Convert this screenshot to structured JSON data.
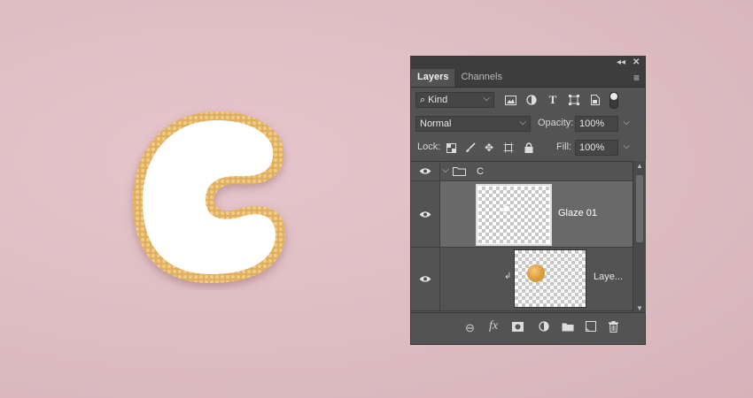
{
  "canvas": {
    "background": "#ddbcc2",
    "cookie_icing": "#ffffff",
    "cookie_crust": "#e2b466"
  },
  "panel": {
    "tabs": [
      {
        "label": "Layers",
        "active": true
      },
      {
        "label": "Channels",
        "active": false
      }
    ],
    "filter": {
      "kind_label": "Kind"
    },
    "blend_mode": "Normal",
    "opacity_label": "Opacity:",
    "opacity_value": "100%",
    "lock_label": "Lock:",
    "fill_label": "Fill:",
    "fill_value": "100%",
    "layers": [
      {
        "name": "C",
        "type": "group",
        "visible": true,
        "expanded": true
      },
      {
        "name": "Glaze 01",
        "type": "layer",
        "visible": true,
        "selected": true
      },
      {
        "name": "Laye...",
        "type": "layer",
        "visible": true,
        "clipped": true
      }
    ]
  },
  "icons": [
    "collapse-icon",
    "close-icon",
    "panel-menu-icon",
    "search-icon",
    "image-filter-icon",
    "adjustment-filter-icon",
    "type-filter-icon",
    "shape-filter-icon",
    "smart-object-filter-icon",
    "filter-toggle-icon",
    "lock-pixels-icon",
    "lock-brush-icon",
    "lock-position-icon",
    "lock-artboard-icon",
    "lock-all-icon",
    "eye-icon",
    "folder-icon",
    "clip-arrow-icon",
    "link-icon",
    "fx-icon",
    "mask-icon",
    "adjustment-icon",
    "new-group-icon",
    "new-layer-icon",
    "trash-icon"
  ]
}
